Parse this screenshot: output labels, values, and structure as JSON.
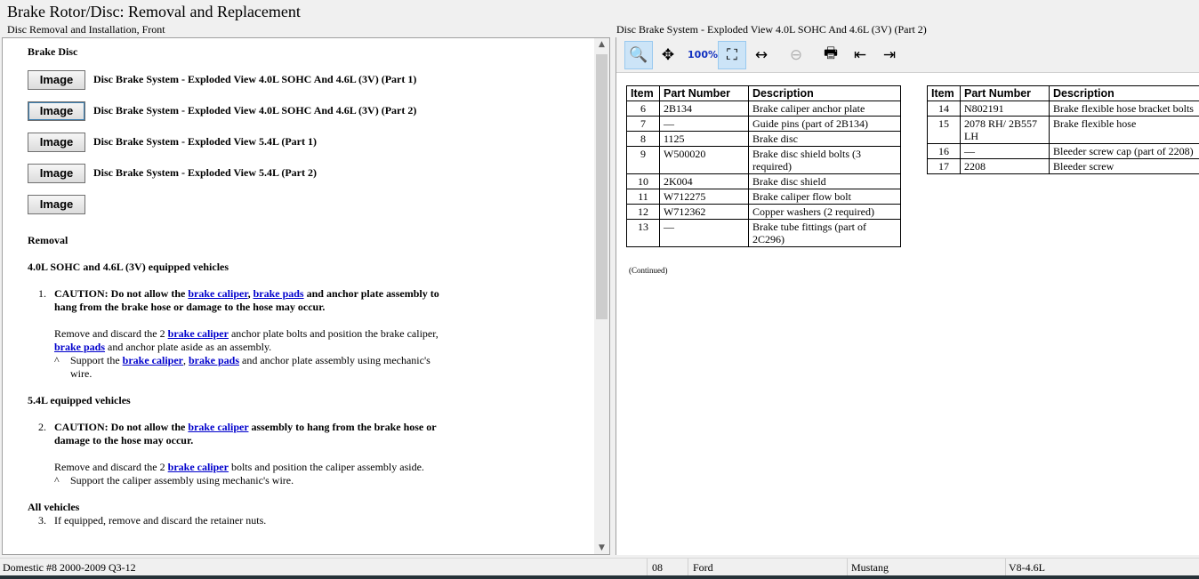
{
  "title": "Brake Rotor/Disc:  Removal and Replacement",
  "subtitle_left": "Disc Removal and Installation, Front",
  "subtitle_right": "Disc Brake System - Exploded View 4.0L SOHC And 4.6L (3V) (Part 2)",
  "left": {
    "brake_disc_heading": "Brake Disc",
    "image_button_label": "Image",
    "images": [
      {
        "label": "Disc Brake System - Exploded View 4.0L SOHC And 4.6L (3V) (Part 1)"
      },
      {
        "label": "Disc Brake System - Exploded View 4.0L SOHC And 4.6L (3V) (Part 2)"
      },
      {
        "label": "Disc Brake System - Exploded View 5.4L (Part 1)"
      },
      {
        "label": "Disc Brake System - Exploded View 5.4L (Part 2)"
      },
      {
        "label": ""
      }
    ],
    "removal_heading": "Removal",
    "sec1_heading": "4.0L SOHC and 4.6L (3V) equipped vehicles",
    "step1_num": "1.",
    "step1_caution": [
      {
        "t": "CAUTION: Do not allow the "
      },
      {
        "t": "brake caliper",
        "link": true
      },
      {
        "t": ", "
      },
      {
        "t": "brake pads",
        "link": true
      },
      {
        "t": " and anchor plate assembly to hang from the brake hose or damage to the hose may occur."
      }
    ],
    "step1_text": [
      {
        "t": "Remove and discard the 2 "
      },
      {
        "t": "brake caliper",
        "link": true
      },
      {
        "t": " anchor plate bolts and position the brake caliper, "
      },
      {
        "t": "brake pads",
        "link": true
      },
      {
        "t": " and anchor plate aside as an assembly."
      }
    ],
    "caret": "^",
    "step1_sub": [
      {
        "t": "Support the "
      },
      {
        "t": "brake caliper",
        "link": true
      },
      {
        "t": ", "
      },
      {
        "t": "brake pads",
        "link": true
      },
      {
        "t": " and anchor plate assembly using mechanic's wire."
      }
    ],
    "sec2_heading": "5.4L equipped vehicles",
    "step2_num": "2.",
    "step2_caution": [
      {
        "t": "CAUTION: Do not allow the "
      },
      {
        "t": "brake caliper",
        "link": true
      },
      {
        "t": " assembly to hang from the brake hose or damage to the hose may occur."
      }
    ],
    "step2_text": [
      {
        "t": "Remove and discard the 2 "
      },
      {
        "t": "brake caliper",
        "link": true
      },
      {
        "t": " bolts and position the caliper assembly aside."
      }
    ],
    "step2_sub": [
      {
        "t": "Support the caliper assembly using mechanic's wire."
      }
    ],
    "sec3_heading": "All vehicles",
    "step3_num": "3.",
    "step3_text": "If equipped, remove and discard the retainer nuts."
  },
  "toolbar": {
    "icons": [
      "zoom-in-icon",
      "pan-icon",
      "zoom-100-icon",
      "zoom-fit-icon",
      "zoom-width-icon",
      "zoom-out-icon",
      "print-icon",
      "previous-image-icon",
      "next-image-icon"
    ]
  },
  "table_headers": [
    "Item",
    "Part Number",
    "Description"
  ],
  "table1": [
    [
      "6",
      "2B134",
      "Brake caliper anchor plate"
    ],
    [
      "7",
      "—",
      "Guide pins (part of 2B134)"
    ],
    [
      "8",
      "1125",
      "Brake disc"
    ],
    [
      "9",
      "W500020",
      "Brake disc shield bolts (3 required)"
    ],
    [
      "10",
      "2K004",
      "Brake disc shield"
    ],
    [
      "11",
      "W712275",
      "Brake caliper flow bolt"
    ],
    [
      "12",
      "W712362",
      "Copper washers (2 required)"
    ],
    [
      "13",
      "—",
      "Brake tube fittings (part of 2C296)"
    ]
  ],
  "table2": [
    [
      "14",
      "N802191",
      "Brake flexible hose bracket bolts"
    ],
    [
      "15",
      "2078 RH/ 2B557 LH",
      "Brake flexible hose"
    ],
    [
      "16",
      "—",
      "Bleeder screw cap (part of 2208)"
    ],
    [
      "17",
      "2208",
      "Bleeder screw"
    ]
  ],
  "continued": "(Continued)",
  "status": {
    "database": "Domestic #8 2000-2009 Q3-12",
    "year": "08",
    "make": "Ford",
    "model": "Mustang",
    "engine": "V8-4.6L"
  }
}
